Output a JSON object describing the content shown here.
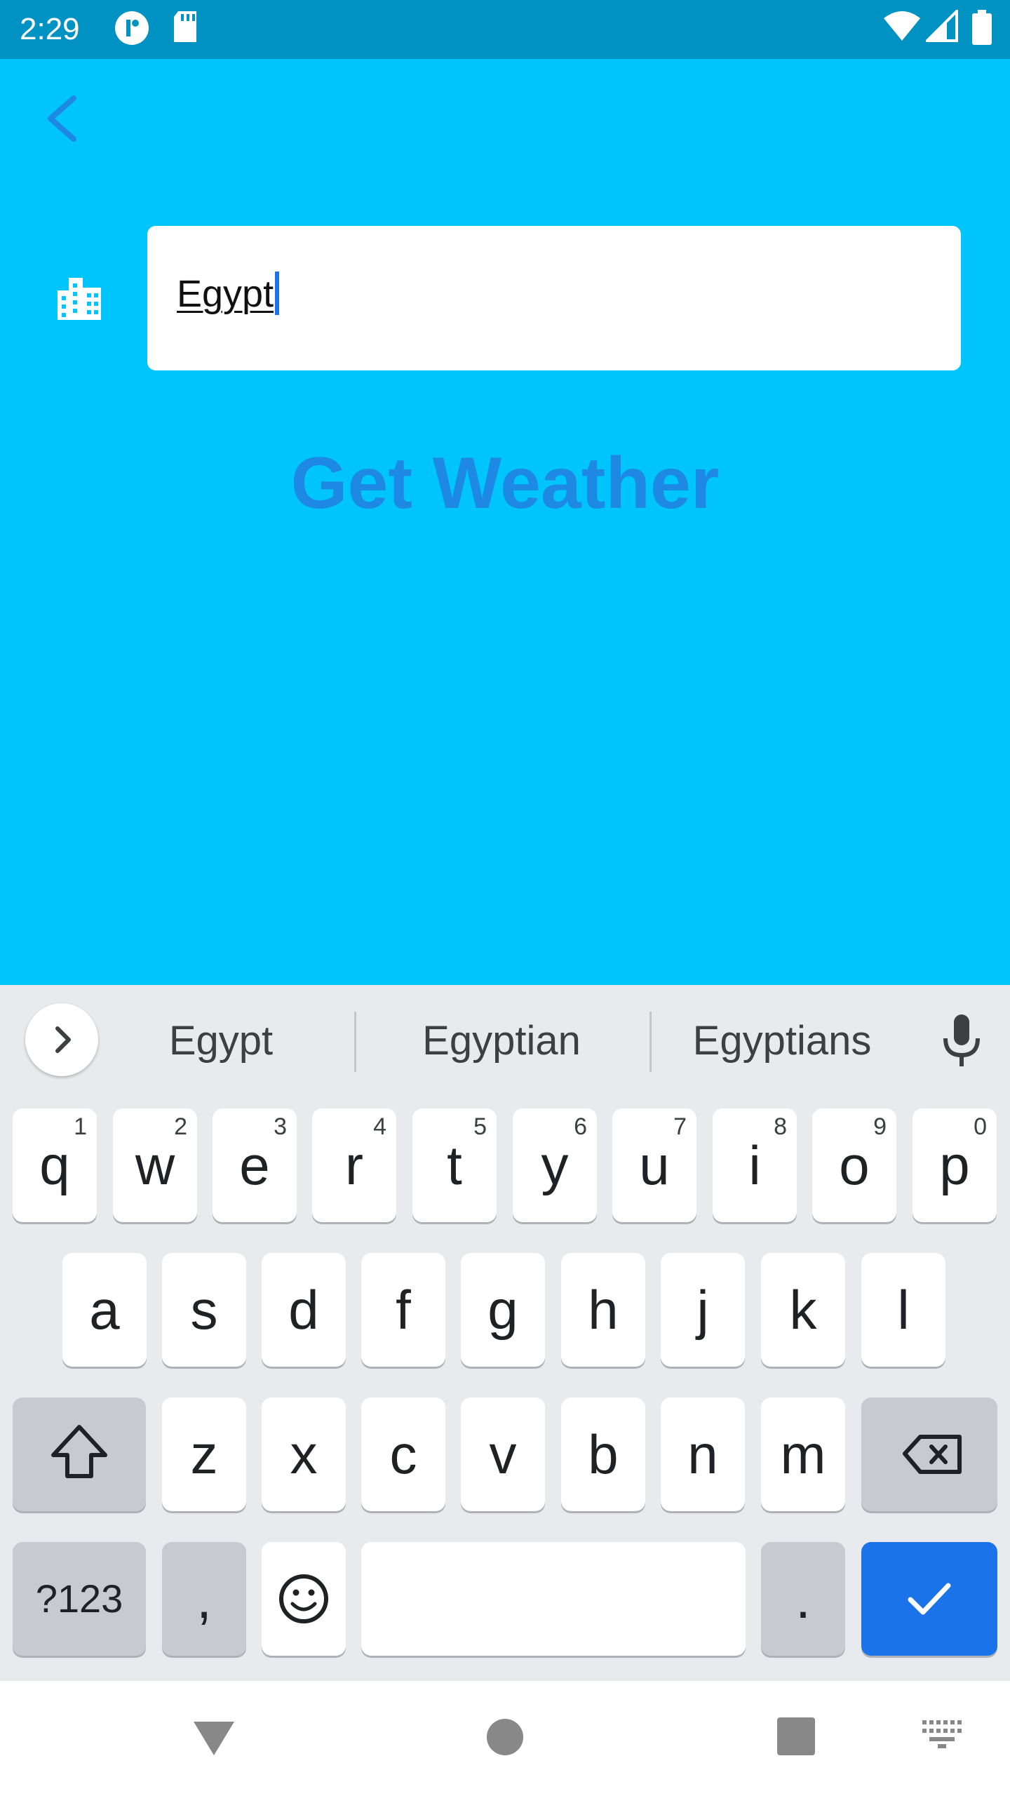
{
  "status_bar": {
    "time": "2:29"
  },
  "city_field": {
    "value": "Egypt"
  },
  "get_weather_label": "Get Weather",
  "keyboard": {
    "suggestions": [
      "Egypt",
      "Egyptian",
      "Egyptians"
    ],
    "row1": [
      {
        "key": "q",
        "hint": "1"
      },
      {
        "key": "w",
        "hint": "2"
      },
      {
        "key": "e",
        "hint": "3"
      },
      {
        "key": "r",
        "hint": "4"
      },
      {
        "key": "t",
        "hint": "5"
      },
      {
        "key": "y",
        "hint": "6"
      },
      {
        "key": "u",
        "hint": "7"
      },
      {
        "key": "i",
        "hint": "8"
      },
      {
        "key": "o",
        "hint": "9"
      },
      {
        "key": "p",
        "hint": "0"
      }
    ],
    "row2": [
      "a",
      "s",
      "d",
      "f",
      "g",
      "h",
      "j",
      "k",
      "l"
    ],
    "row3": [
      "z",
      "x",
      "c",
      "v",
      "b",
      "n",
      "m"
    ],
    "sym_label": "?123",
    "comma": ",",
    "period": "."
  },
  "colors": {
    "app_bg": "#00c5fd",
    "status_bar": "#0092c2",
    "accent": "#1e88e5",
    "key_action": "#1a73e8"
  }
}
